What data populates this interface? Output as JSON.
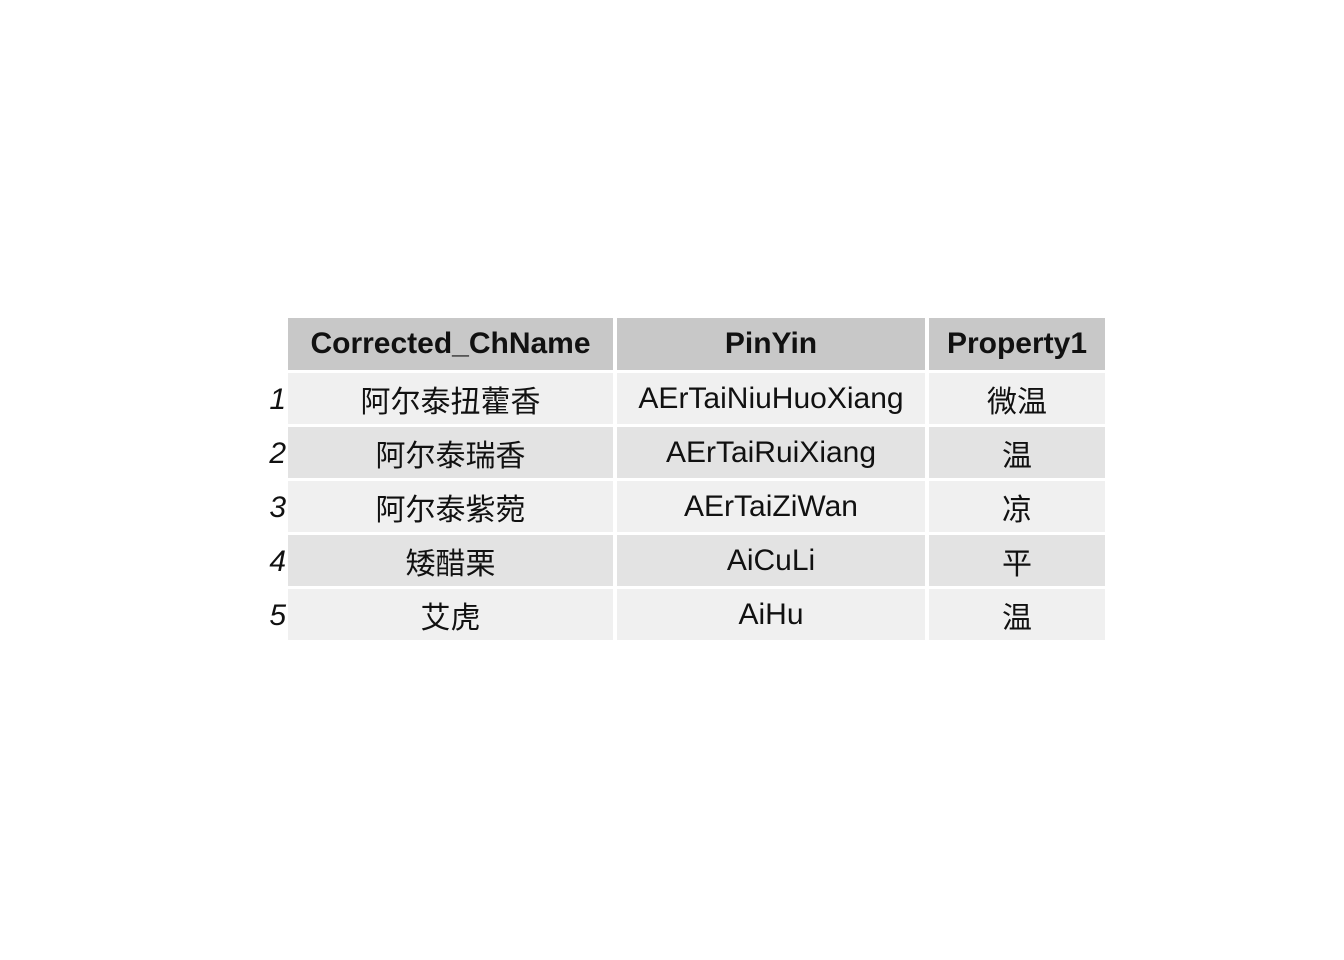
{
  "chart_data": {
    "type": "table",
    "columns": [
      "Corrected_ChName",
      "PinYin",
      "Property1"
    ],
    "row_index": [
      "1",
      "2",
      "3",
      "4",
      "5"
    ],
    "rows": [
      [
        "阿尔泰扭藿香",
        "AErTaiNiuHuoXiang",
        "微温"
      ],
      [
        "阿尔泰瑞香",
        "AErTaiRuiXiang",
        "温"
      ],
      [
        "阿尔泰紫菀",
        "AErTaiZiWan",
        "凉"
      ],
      [
        "矮醋栗",
        "AiCuLi",
        "平"
      ],
      [
        "艾虎",
        "AiHu",
        "温"
      ]
    ]
  }
}
